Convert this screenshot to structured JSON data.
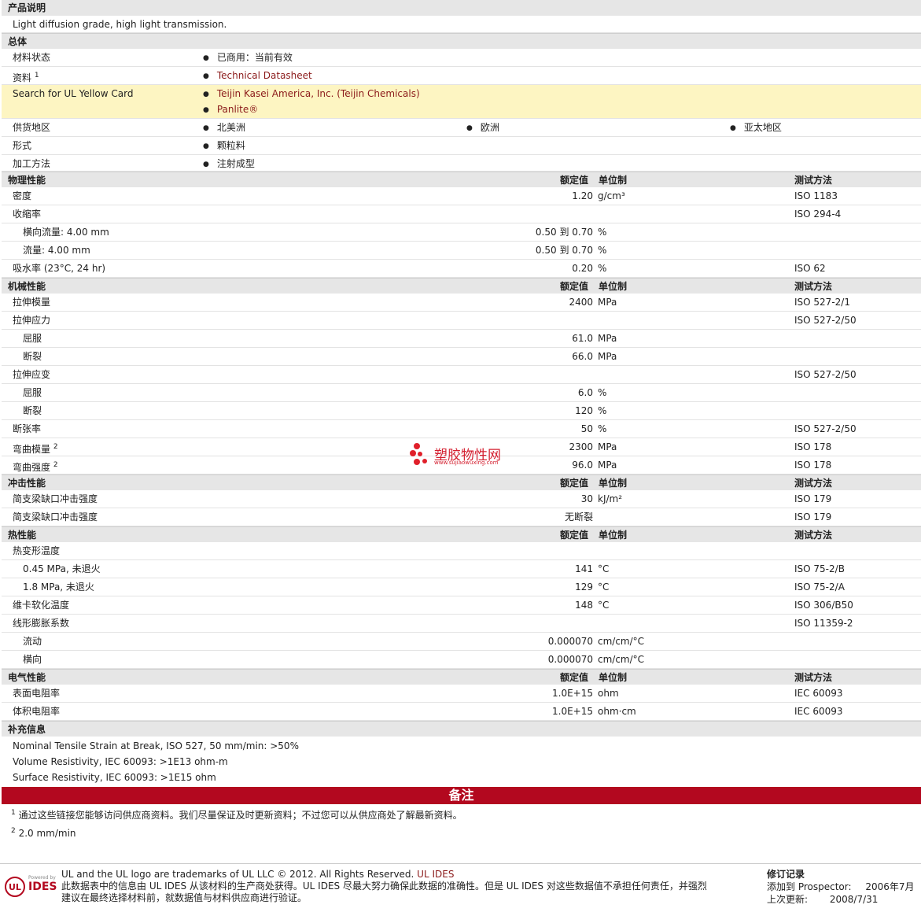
{
  "desc": {
    "title": "产品说明",
    "text": "Light diffusion grade, high light transmission."
  },
  "general": {
    "title": "总体",
    "material_status_label": "材料状态",
    "material_status": "已商用：当前有效",
    "source_label": "资料",
    "source_sup": "1",
    "source_link": "Technical Datasheet",
    "yellow_label": "Search for UL Yellow Card",
    "yellow_link1": "Teijin Kasei America, Inc. (Teijin Chemicals)",
    "yellow_link2": "Panlite®",
    "region_label": "供货地区",
    "regions": [
      "北美洲",
      "欧洲",
      "亚太地区"
    ],
    "form_label": "形式",
    "form": "颗粒料",
    "process_label": "加工方法",
    "process": "注射成型"
  },
  "hdr": {
    "nominal": "额定值",
    "unit": "单位制",
    "method": "测试方法"
  },
  "physical": {
    "title": "物理性能",
    "rows": [
      {
        "label": "密度",
        "value": "1.20",
        "unit": "g/cm³",
        "method": "ISO 1183"
      },
      {
        "label": "收缩率",
        "value": "",
        "unit": "",
        "method": "ISO 294-4"
      },
      {
        "label": "横向流量: 4.00 mm",
        "value": "0.50 到  0.70",
        "unit": "%",
        "method": ""
      },
      {
        "label": "流量: 4.00 mm",
        "value": "0.50 到  0.70",
        "unit": "%",
        "method": ""
      },
      {
        "label": "吸水率 (23°C, 24 hr)",
        "value": "0.20",
        "unit": "%",
        "method": "ISO 62"
      }
    ]
  },
  "mechanical": {
    "title": "机械性能",
    "rows": [
      {
        "label": "拉伸模量",
        "value": "2400",
        "unit": "MPa",
        "method": "ISO 527-2/1"
      },
      {
        "label": "拉伸应力",
        "value": "",
        "unit": "",
        "method": "ISO 527-2/50"
      },
      {
        "label": "屈服",
        "value": "61.0",
        "unit": "MPa",
        "method": ""
      },
      {
        "label": "断裂",
        "value": "66.0",
        "unit": "MPa",
        "method": ""
      },
      {
        "label": "拉伸应变",
        "value": "",
        "unit": "",
        "method": "ISO 527-2/50"
      },
      {
        "label": "屈服",
        "value": "6.0",
        "unit": "%",
        "method": ""
      },
      {
        "label": "断裂",
        "value": "120",
        "unit": "%",
        "method": ""
      },
      {
        "label": "断张率",
        "value": "50",
        "unit": "%",
        "method": "ISO 527-2/50"
      },
      {
        "label": "弯曲模量",
        "sup": "2",
        "value": "2300",
        "unit": "MPa",
        "method": "ISO 178"
      },
      {
        "label": "弯曲强度",
        "sup": "2",
        "value": "96.0",
        "unit": "MPa",
        "method": "ISO 178"
      }
    ]
  },
  "impact": {
    "title": "冲击性能",
    "rows": [
      {
        "label": "简支梁缺口冲击强度",
        "value": "30",
        "unit": "kJ/m²",
        "method": "ISO 179"
      },
      {
        "label": "简支梁缺口冲击强度",
        "value": "无断裂",
        "unit": "",
        "method": "ISO 179"
      }
    ]
  },
  "thermal": {
    "title": "热性能",
    "rows": [
      {
        "label": "热变形温度",
        "value": "",
        "unit": "",
        "method": ""
      },
      {
        "label": "0.45 MPa, 未退火",
        "value": "141",
        "unit": "°C",
        "method": "ISO 75-2/B"
      },
      {
        "label": "1.8 MPa, 未退火",
        "value": "129",
        "unit": "°C",
        "method": "ISO 75-2/A"
      },
      {
        "label": "维卡软化温度",
        "value": "148",
        "unit": "°C",
        "method": "ISO 306/B50"
      },
      {
        "label": "线形膨胀系数",
        "value": "",
        "unit": "",
        "method": "ISO 11359-2"
      },
      {
        "label": "流动",
        "value": "0.000070",
        "unit": "cm/cm/°C",
        "method": ""
      },
      {
        "label": "横向",
        "value": "0.000070",
        "unit": "cm/cm/°C",
        "method": ""
      }
    ]
  },
  "electrical": {
    "title": "电气性能",
    "rows": [
      {
        "label": "表面电阻率",
        "value": "1.0E+15",
        "unit": "ohm",
        "method": "IEC 60093"
      },
      {
        "label": "体积电阻率",
        "value": "1.0E+15",
        "unit": "ohm·cm",
        "method": "IEC 60093"
      }
    ]
  },
  "supp": {
    "title": "补充信息",
    "lines": [
      "Nominal Tensile Strain at Break, ISO 527, 50 mm/min: >50%",
      "Volume Resistivity, IEC 60093: >1E13 ohm-m",
      "Surface Resistivity, IEC 60093: >1E15 ohm"
    ]
  },
  "notes": {
    "title": "备注",
    "n1_sup": "1",
    "n1": "通过这些链接您能够访问供应商资料。我们尽量保证及时更新资料；不过您可以从供应商处了解最新资料。",
    "n2_sup": "2",
    "n2": "2.0 mm/min"
  },
  "watermark": {
    "name": "塑胶物性网",
    "url": "www.sujiaowuxing.com"
  },
  "footer": {
    "powered": "Powered by",
    "ids": "IDES",
    "ul": "UL",
    "line1": "UL and the UL logo are trademarks of UL LLC © 2012. All Rights Reserved. ",
    "line1_link": "UL IDES",
    "line2": "此数据表中的信息由 UL IDES 从该材料的生产商处获得。UL IDES 尽最大努力确保此数据的准确性。但是 UL IDES 对这些数据值不承担任何责任，并强烈",
    "line3": "建议在最终选择材料前，就数据值与材料供应商进行验证。",
    "rev_title": "修订记录",
    "added_label": "添加到 Prospector:",
    "added": "2006年7月",
    "updated_label": "上次更新:",
    "updated": "2008/7/31"
  }
}
